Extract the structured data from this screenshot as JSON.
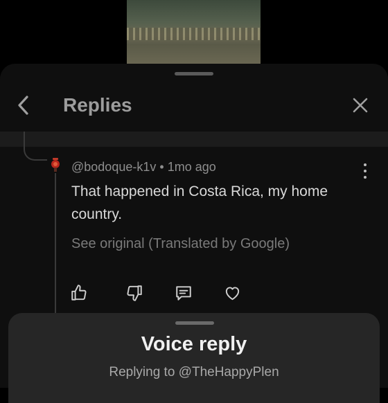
{
  "header": {
    "title": "Replies"
  },
  "reply": {
    "author": "@bodoque-k1v",
    "separator": "•",
    "time": "1mo ago",
    "text": "That happened in Costa Rica, my home country.",
    "see_original": "See original (Translated by Google)"
  },
  "voice_reply": {
    "title": "Voice reply",
    "replying_to": "Replying to @TheHappyPlen"
  },
  "colors": {
    "sheet_bg": "#0f0f0f",
    "voice_sheet_bg": "#262626",
    "muted_text": "#8e8e8e"
  }
}
